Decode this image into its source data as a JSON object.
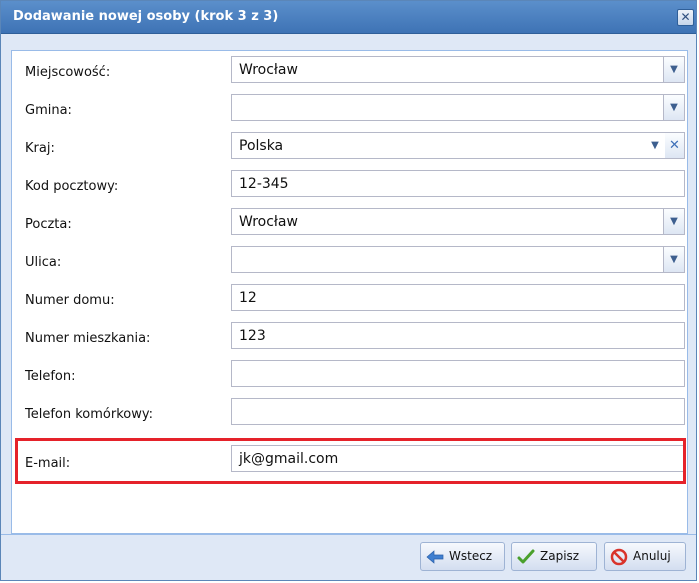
{
  "dialog": {
    "title": "Dodawanie nowej osoby (krok 3 z 3)",
    "close_glyph": "✕"
  },
  "form": {
    "fields": [
      {
        "label": "Miejscowość:",
        "value": "Wrocław",
        "type": "combo"
      },
      {
        "label": "Gmina:",
        "value": "",
        "type": "combo"
      },
      {
        "label": "Kraj:",
        "value": "Polska",
        "type": "combo-clear"
      },
      {
        "label": "Kod pocztowy:",
        "value": "12-345",
        "type": "text"
      },
      {
        "label": "Poczta:",
        "value": "Wrocław",
        "type": "combo"
      },
      {
        "label": "Ulica:",
        "value": "",
        "type": "combo"
      },
      {
        "label": "Numer domu:",
        "value": "12",
        "type": "text"
      },
      {
        "label": "Numer mieszkania:",
        "value": "123",
        "type": "text"
      },
      {
        "label": "Telefon:",
        "value": "",
        "type": "text"
      },
      {
        "label": "Telefon komórkowy:",
        "value": "",
        "type": "text"
      },
      {
        "label": "E-mail:",
        "value": "jk@gmail.com",
        "type": "text"
      }
    ]
  },
  "buttons": {
    "back": "Wstecz",
    "save": "Zapisz",
    "cancel": "Anuluj"
  },
  "icons": {
    "dropdown": "chevron-down-icon",
    "clear": "clear-x-icon",
    "back": "arrow-left-icon",
    "save": "checkmark-icon",
    "cancel": "cancel-circle-icon"
  },
  "colors": {
    "titlebar": "#3e73b5",
    "highlight": "#e5222a",
    "panel": "#dfe8f6"
  }
}
